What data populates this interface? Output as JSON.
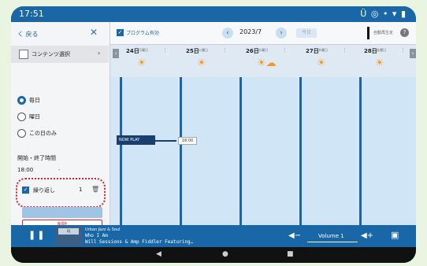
{
  "status": {
    "time": "17:51",
    "icons": "Ü ◎ • ▾ ▮"
  },
  "panel": {
    "back_label": "く 戻る",
    "close_label": "✕",
    "content_select": "コンテンツ選択",
    "content_arrow": "›",
    "repeat_options": [
      "毎日",
      "曜日",
      "この日のみ"
    ],
    "period_label": "開始・終了時間",
    "start_time": "18:00",
    "time_sep": "-",
    "repeat_label": "繰り返し",
    "repeat_count": "1",
    "save_label": "",
    "delete_label": "削除"
  },
  "toolbar": {
    "program_label": "プログラム有効",
    "month": "2023/7",
    "prev": "‹",
    "next": "›",
    "today": "今日",
    "right_label": "自動再生定"
  },
  "days": [
    {
      "date": "24日",
      "weekday": "月曜日",
      "weather": "☀"
    },
    {
      "date": "25日",
      "weekday": "火曜日",
      "weather": "☀"
    },
    {
      "date": "26日",
      "weekday": "水曜日",
      "weather": "☀☁"
    },
    {
      "date": "27日",
      "weekday": "木曜日",
      "weather": "☀"
    },
    {
      "date": "28日",
      "weekday": "金曜日",
      "weather": "☀"
    }
  ],
  "schedule": {
    "now_play_label": "NOW PLAY",
    "now_time": "18:00"
  },
  "player": {
    "station": "Urban Jazz & Soul",
    "title": "Who I Am",
    "artist": "Will Sessions & Amp Fiddler Featuring…",
    "thumb_label": "DJ",
    "volume_label": "Volume 1"
  },
  "navbar": {
    "back": "◀",
    "home": "●",
    "recent": "■"
  }
}
